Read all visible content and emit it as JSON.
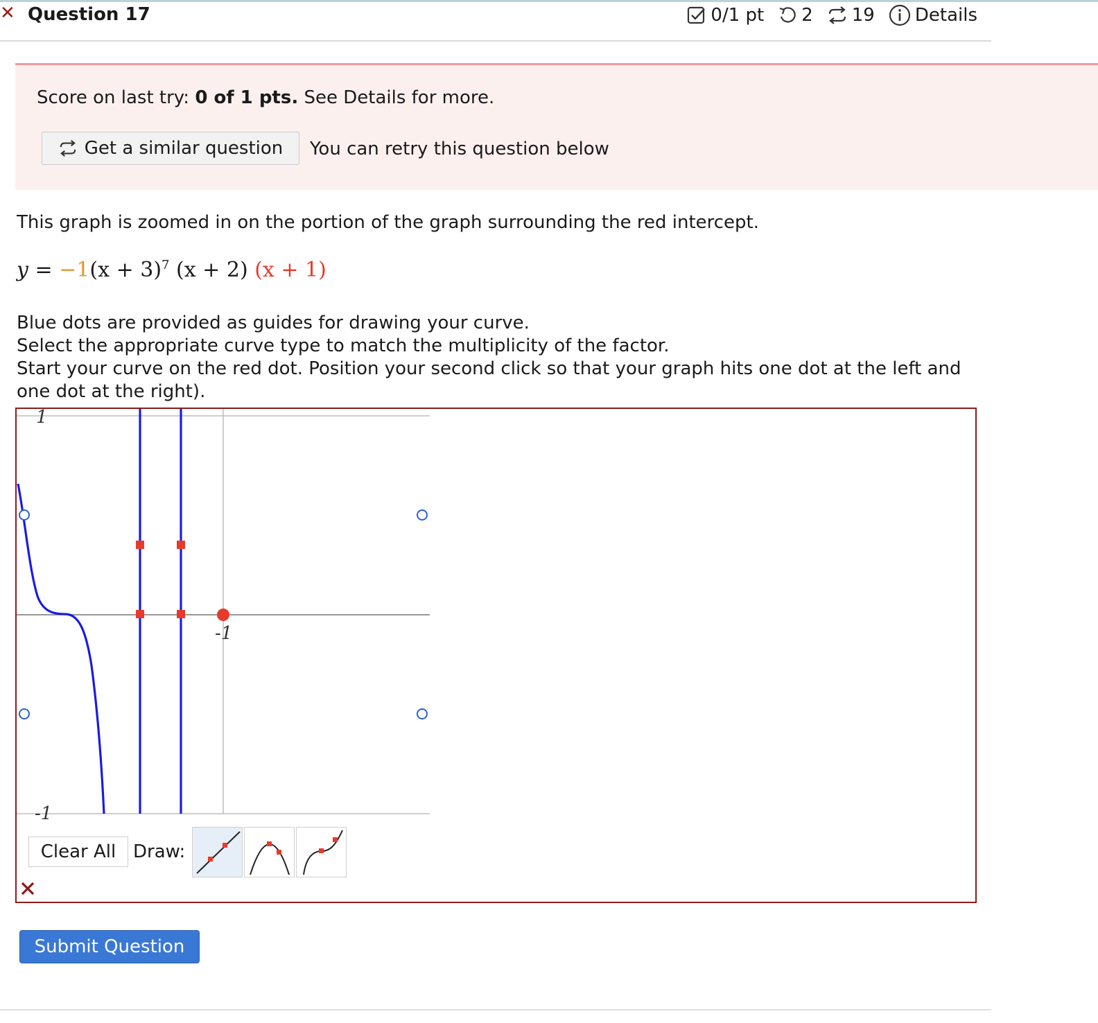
{
  "header": {
    "title": "Question 17",
    "score": "0/1 pt",
    "retries": "2",
    "attempts": "19",
    "details": "Details"
  },
  "banner": {
    "score_prefix": "Score on last try: ",
    "score_bold": "0 of 1 pts.",
    "score_suffix": " See Details for more.",
    "similar_button": "Get a similar question",
    "retry_note": "You can retry this question below"
  },
  "question": {
    "intro": "This graph is zoomed in on the portion of the graph surrounding the red intercept.",
    "equation": {
      "lhs": "y",
      "eq": " = ",
      "coef": "−1",
      "f1": "(x + 3)",
      "f1_exp": "7",
      "f2": " (x + 2) ",
      "f3": "(x + 1)"
    },
    "instructions": [
      "Blue dots are provided as guides for drawing your curve.",
      "Select the appropriate curve type to match the multiplicity of the factor.",
      "Start your curve on the red dot. Position your second click so that your graph hits one dot at the left and one dot at the right)."
    ]
  },
  "graph": {
    "y_top_label": "1",
    "y_bottom_label": "-1",
    "x_label": "-1",
    "clear_button": "Clear All",
    "draw_label": "Draw:",
    "tools": [
      "line-tool",
      "parabola-tool",
      "cubic-tool"
    ],
    "selected_tool": "line-tool",
    "colors": {
      "curve": "#1a1ae6",
      "intercept": "#e83a2a",
      "guide_dot": "#2a5fd6",
      "frame": "#8b1a1a"
    }
  },
  "submit": {
    "label": "Submit Question"
  }
}
